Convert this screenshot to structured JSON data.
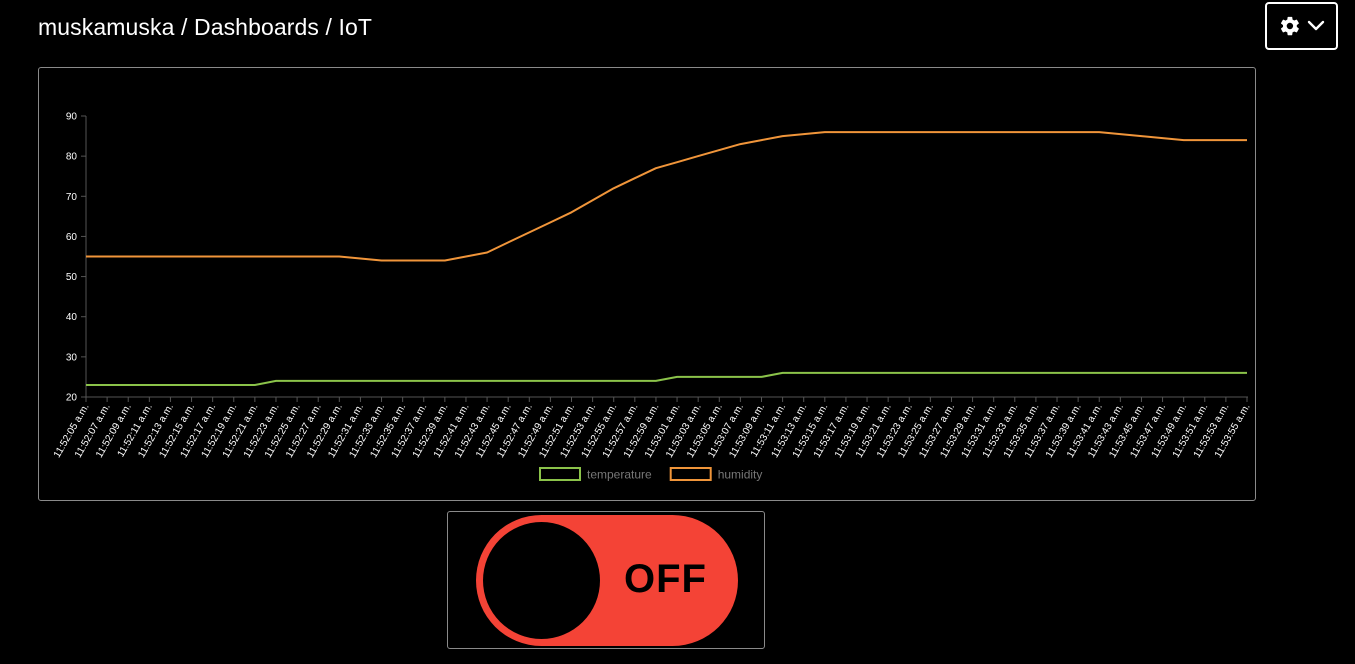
{
  "breadcrumb": {
    "items": [
      "muskamuska",
      "Dashboards",
      "IoT"
    ],
    "separator": "/"
  },
  "settings": {
    "icons": [
      "gear-icon",
      "chevron-down-icon"
    ]
  },
  "chart_data": {
    "type": "line",
    "title": "",
    "xlabel": "",
    "ylabel": "",
    "ylim": [
      20,
      90
    ],
    "yticks": [
      20,
      30,
      40,
      50,
      60,
      70,
      80,
      90
    ],
    "grid": false,
    "legend_position": "bottom",
    "categories": [
      "11:52:05 a.m.",
      "11:52:07 a.m.",
      "11:52:09 a.m.",
      "11:52:11 a.m.",
      "11:52:13 a.m.",
      "11:52:15 a.m.",
      "11:52:17 a.m.",
      "11:52:19 a.m.",
      "11:52:21 a.m.",
      "11:52:23 a.m.",
      "11:52:25 a.m.",
      "11:52:27 a.m.",
      "11:52:29 a.m.",
      "11:52:31 a.m.",
      "11:52:33 a.m.",
      "11:52:35 a.m.",
      "11:52:37 a.m.",
      "11:52:39 a.m.",
      "11:52:41 a.m.",
      "11:52:43 a.m.",
      "11:52:45 a.m.",
      "11:52:47 a.m.",
      "11:52:49 a.m.",
      "11:52:51 a.m.",
      "11:52:53 a.m.",
      "11:52:55 a.m.",
      "11:52:57 a.m.",
      "11:52:59 a.m.",
      "11:53:01 a.m.",
      "11:53:03 a.m.",
      "11:53:05 a.m.",
      "11:53:07 a.m.",
      "11:53:09 a.m.",
      "11:53:11 a.m.",
      "11:53:13 a.m.",
      "11:53:15 a.m.",
      "11:53:17 a.m.",
      "11:53:19 a.m.",
      "11:53:21 a.m.",
      "11:53:23 a.m.",
      "11:53:25 a.m.",
      "11:53:27 a.m.",
      "11:53:29 a.m.",
      "11:53:31 a.m.",
      "11:53:33 a.m.",
      "11:53:35 a.m.",
      "11:53:37 a.m.",
      "11:53:39 a.m.",
      "11:53:41 a.m.",
      "11:53:43 a.m.",
      "11:53:45 a.m.",
      "11:53:47 a.m.",
      "11:53:49 a.m.",
      "11:53:51 a.m.",
      "11:53:53 a.m.",
      "11:53:55 a.m."
    ],
    "series": [
      {
        "name": "temperature",
        "color": "#8bc34a",
        "values": [
          23,
          23,
          23,
          23,
          23,
          23,
          23,
          23,
          23,
          24,
          24,
          24,
          24,
          24,
          24,
          24,
          24,
          24,
          24,
          24,
          24,
          24,
          24,
          24,
          24,
          24,
          24,
          24,
          25,
          25,
          25,
          25,
          25,
          26,
          26,
          26,
          26,
          26,
          26,
          26,
          26,
          26,
          26,
          26,
          26,
          26,
          26,
          26,
          26,
          26,
          26,
          26,
          26,
          26,
          26,
          26
        ]
      },
      {
        "name": "humidity",
        "color": "#f0953a",
        "values": [
          55,
          55,
          55,
          55,
          55,
          55,
          55,
          55,
          55,
          55,
          55,
          55,
          55,
          54.5,
          54,
          54,
          54,
          54,
          55,
          56,
          58.5,
          61,
          63.5,
          66,
          69,
          72,
          74.5,
          77,
          78.5,
          80,
          81.5,
          83,
          84,
          85,
          85.5,
          86,
          86,
          86,
          86,
          86,
          86,
          86,
          86,
          86,
          86,
          86,
          86,
          86,
          86,
          85.5,
          85,
          84.5,
          84,
          84,
          84,
          84
        ]
      }
    ]
  },
  "toggle": {
    "label": "OFF",
    "state": "off",
    "color": "#f44336"
  }
}
